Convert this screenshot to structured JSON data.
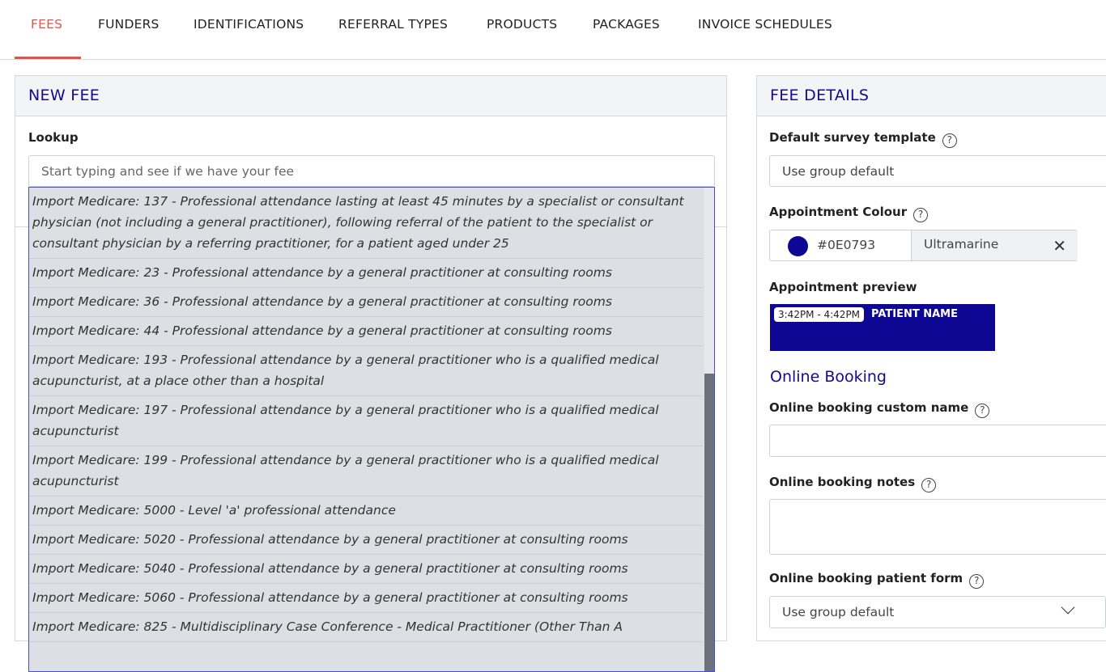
{
  "tabs": [
    {
      "label": "FEES",
      "active": true
    },
    {
      "label": "FUNDERS"
    },
    {
      "label": "IDENTIFICATIONS"
    },
    {
      "label": "REFERRAL TYPES"
    },
    {
      "label": "PRODUCTS"
    },
    {
      "label": "PACKAGES"
    },
    {
      "label": "INVOICE SCHEDULES"
    }
  ],
  "new_fee": {
    "title": "NEW FEE",
    "lookup_label": "Lookup",
    "lookup_placeholder": "Start typing and see if we have your fee",
    "results": [
      "Import Medicare: 137 - Professional attendance lasting at least 45 minutes by a specialist or consultant physician (not including a general practitioner), following referral of the patient to the specialist or consultant physician by a referring practitioner, for a patient aged under 25",
      "Import Medicare: 23 - Professional attendance by a general practitioner at consulting rooms",
      "Import Medicare: 36 - Professional attendance by a general practitioner at consulting rooms",
      "Import Medicare: 44 - Professional attendance by a general practitioner at consulting rooms",
      "Import Medicare: 193 - Professional attendance by a general practitioner who is a qualified medical acupuncturist, at a place other than a hospital",
      "Import Medicare: 197 - Professional attendance by a general practitioner who is a qualified medical acupuncturist",
      "Import Medicare: 199 - Professional attendance by a general practitioner who is a qualified medical acupuncturist",
      "Import Medicare: 5000 - Level 'a' professional attendance",
      "Import Medicare: 5020 - Professional attendance by a general practitioner at consulting rooms",
      "Import Medicare: 5040 - Professional attendance by a general practitioner at consulting rooms",
      "Import Medicare: 5060 - Professional attendance by a general practitioner at consulting rooms",
      "Import Medicare: 825 - Multidisciplinary Case Conference - Medical Practitioner (Other Than A"
    ]
  },
  "fee_details": {
    "title": "FEE DETAILS",
    "survey_label": "Default survey template",
    "survey_value": "Use group default",
    "colour_label": "Appointment Colour",
    "colour_hex": "#0E0793",
    "colour_name": "Ultramarine",
    "preview_label": "Appointment preview",
    "preview_time": "3:42PM - 4:42PM",
    "preview_patient": "PATIENT NAME",
    "online_booking_title": "Online Booking",
    "custom_name_label": "Online booking custom name",
    "custom_name_value": "",
    "notes_label": "Online booking notes",
    "notes_value": "",
    "patient_form_label": "Online booking patient form",
    "patient_form_value": "Use group default"
  },
  "colors": {
    "accent": "#e0554a",
    "header_text": "#130a8c",
    "appointment": "#0E0793"
  },
  "icons": [
    "help-icon",
    "close-icon",
    "chevron-down-icon"
  ]
}
